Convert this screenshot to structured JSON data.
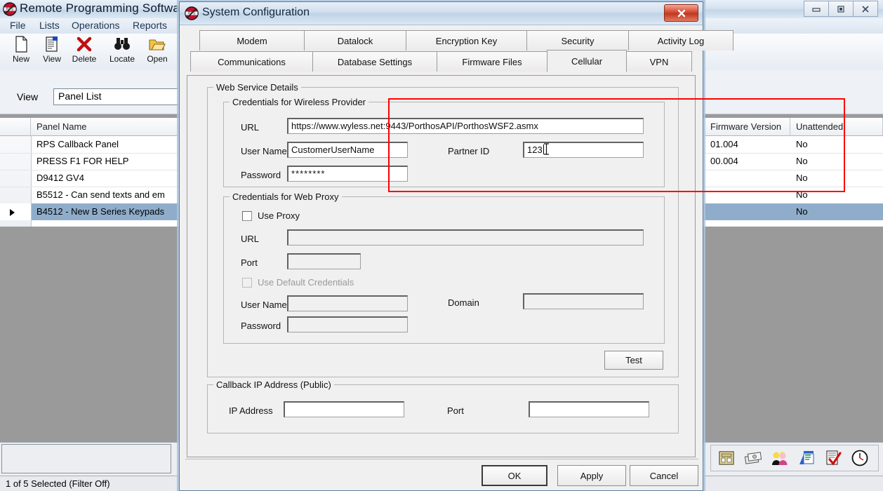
{
  "app": {
    "title": "Remote Programming Software",
    "icon": "rps-logo-icon",
    "window_controls": [
      {
        "name": "minimize",
        "glyph": "▭"
      },
      {
        "name": "restore",
        "glyph": "❐"
      },
      {
        "name": "close",
        "glyph": "✕"
      }
    ],
    "menus": [
      "File",
      "Lists",
      "Operations",
      "Reports"
    ],
    "toolbar": [
      {
        "label": "New",
        "icon": "new-document-icon"
      },
      {
        "label": "View",
        "icon": "view-document-icon"
      },
      {
        "label": "Delete",
        "icon": "delete-x-icon"
      },
      {
        "label": "Locate",
        "icon": "binoculars-icon"
      },
      {
        "label": "Open",
        "icon": "open-folder-icon"
      }
    ],
    "view_bar": {
      "label": "View",
      "value": "Panel List"
    },
    "grid": {
      "columns": [
        "Panel Name",
        "Firmware Version",
        "Unattended"
      ],
      "rows": [
        {
          "panel_name": "RPS Callback Panel",
          "firmware_version": "01.004",
          "unattended": "No",
          "selected": false,
          "marker": false
        },
        {
          "panel_name": "PRESS F1 FOR HELP",
          "firmware_version": "00.004",
          "unattended": "No",
          "selected": false,
          "marker": false
        },
        {
          "panel_name": "D9412 GV4",
          "firmware_version": "",
          "unattended": "No",
          "selected": false,
          "marker": false
        },
        {
          "panel_name": "B5512 - Can send texts and em",
          "firmware_version": "",
          "unattended": "No",
          "selected": false,
          "marker": false
        },
        {
          "panel_name": "B4512 - New B Series Keypads",
          "firmware_version": "",
          "unattended": "No",
          "selected": true,
          "marker": true
        }
      ]
    },
    "status_bar": "1 of 5 Selected (Filter Off)",
    "right_toolstrip": [
      {
        "icon": "keypad-icon"
      },
      {
        "icon": "money-icon"
      },
      {
        "icon": "people-icon"
      },
      {
        "icon": "chart-report-icon"
      },
      {
        "icon": "checked-document-icon"
      },
      {
        "icon": "clock-icon"
      }
    ]
  },
  "dialog": {
    "title": "System Configuration",
    "icon": "rps-logo-icon",
    "close_glyph": "✕",
    "tabs_row1": [
      "Modem",
      "Datalock",
      "Encryption Key",
      "Security",
      "Activity Log"
    ],
    "tabs_row2": [
      "Communications",
      "Database Settings",
      "Firmware Files",
      "Cellular",
      "VPN"
    ],
    "selected_tab": "Cellular",
    "web_service_details": {
      "title": "Web Service Details",
      "wireless": {
        "title": "Credentials for Wireless Provider",
        "url_label": "URL",
        "url_value": "https://www.wyless.net:9443/PorthosAPI/PorthosWSF2.asmx",
        "username_label": "User Name",
        "username_value": "CustomerUserName",
        "partner_id_label": "Partner ID",
        "partner_id_value": "123",
        "password_label": "Password",
        "password_value": "••••••••",
        "password_masked": "********"
      },
      "proxy": {
        "title": "Credentials for Web Proxy",
        "use_proxy_label": "Use Proxy",
        "use_proxy_checked": false,
        "url_label": "URL",
        "url_value": "",
        "port_label": "Port",
        "port_value": "",
        "use_default_credentials_label": "Use Default Credentials",
        "use_default_credentials_checked": false,
        "use_default_credentials_disabled": true,
        "username_label": "User Name",
        "username_value": "",
        "domain_label": "Domain",
        "domain_value": "",
        "password_label": "Password",
        "password_value": ""
      },
      "test_button": "Test"
    },
    "callback": {
      "title": "Callback IP Address (Public)",
      "ip_label": "IP Address",
      "ip_value": "",
      "port_label": "Port",
      "port_value": ""
    },
    "buttons": {
      "ok": "OK",
      "apply": "Apply",
      "cancel": "Cancel"
    },
    "highlight_color": "#ff0000"
  }
}
